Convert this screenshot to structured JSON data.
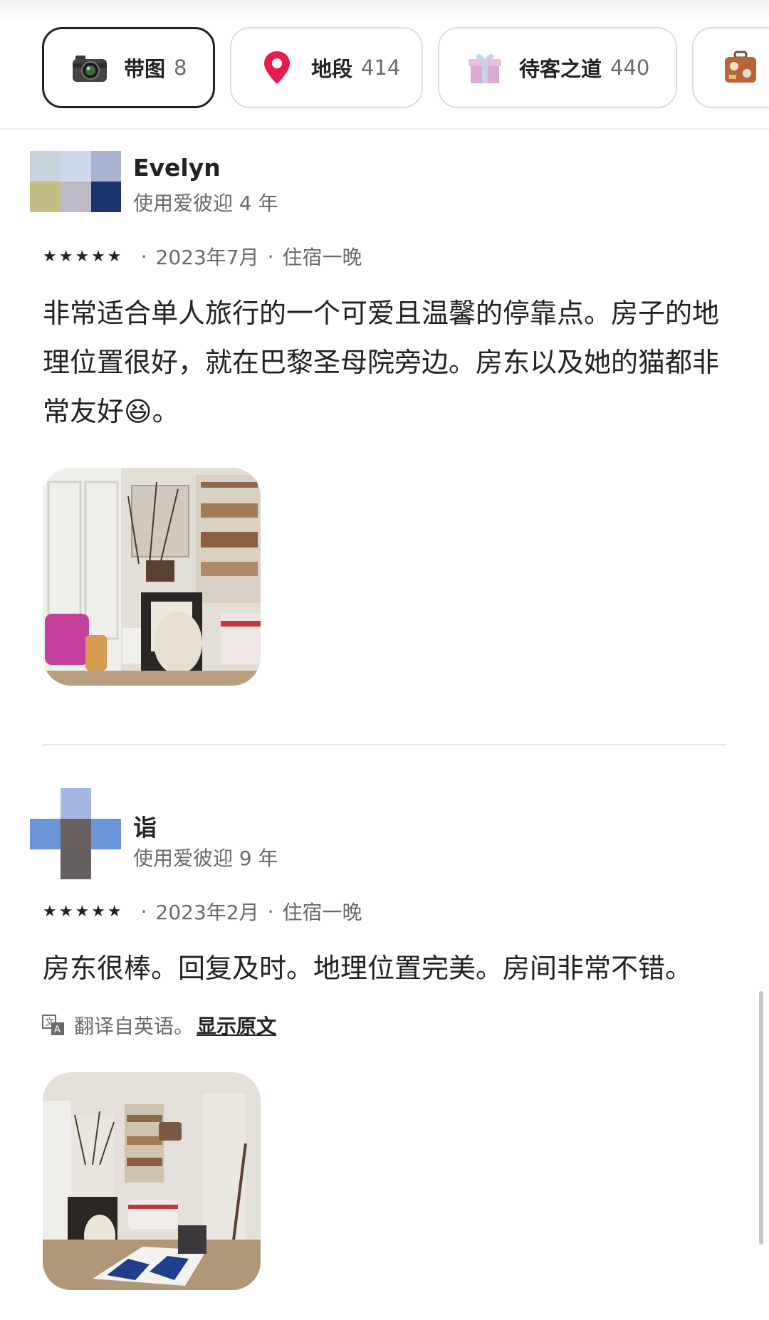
{
  "filters": [
    {
      "label": "带图",
      "count": "8",
      "icon": "camera-icon",
      "active": true
    },
    {
      "label": "地段",
      "count": "414",
      "icon": "location-pin-icon",
      "active": false
    },
    {
      "label": "待客之道",
      "count": "440",
      "icon": "gift-icon",
      "active": false
    },
    {
      "label": "",
      "count": "",
      "icon": "suitcase-icon",
      "active": false
    }
  ],
  "reviews": [
    {
      "name": "Evelyn",
      "tenure": "使用爱彼迎 4 年",
      "rating": 5,
      "date": "2023年7月",
      "stay": "住宿一晚",
      "text": "非常适合单人旅行的一个可爱且温馨的停靠点。房子的地理位置很好，就在巴黎圣母院旁边。房东以及她的猫都非常友好😆。",
      "photo": "living-room-fireplace-photo"
    },
    {
      "name": "诣",
      "tenure": "使用爱彼迎 9 年",
      "rating": 5,
      "date": "2023年2月",
      "stay": "住宿一晚",
      "text": "房东很棒。回复及时。地理位置完美。房间非常不错。",
      "translation_note": "翻译自英语。",
      "show_original": "显示原文",
      "photo": "bedroom-overview-photo"
    }
  ],
  "colors": {
    "text": "#222222",
    "secondary": "#6a6a6a",
    "border": "#dddddd",
    "pin": "#e61e4d"
  }
}
